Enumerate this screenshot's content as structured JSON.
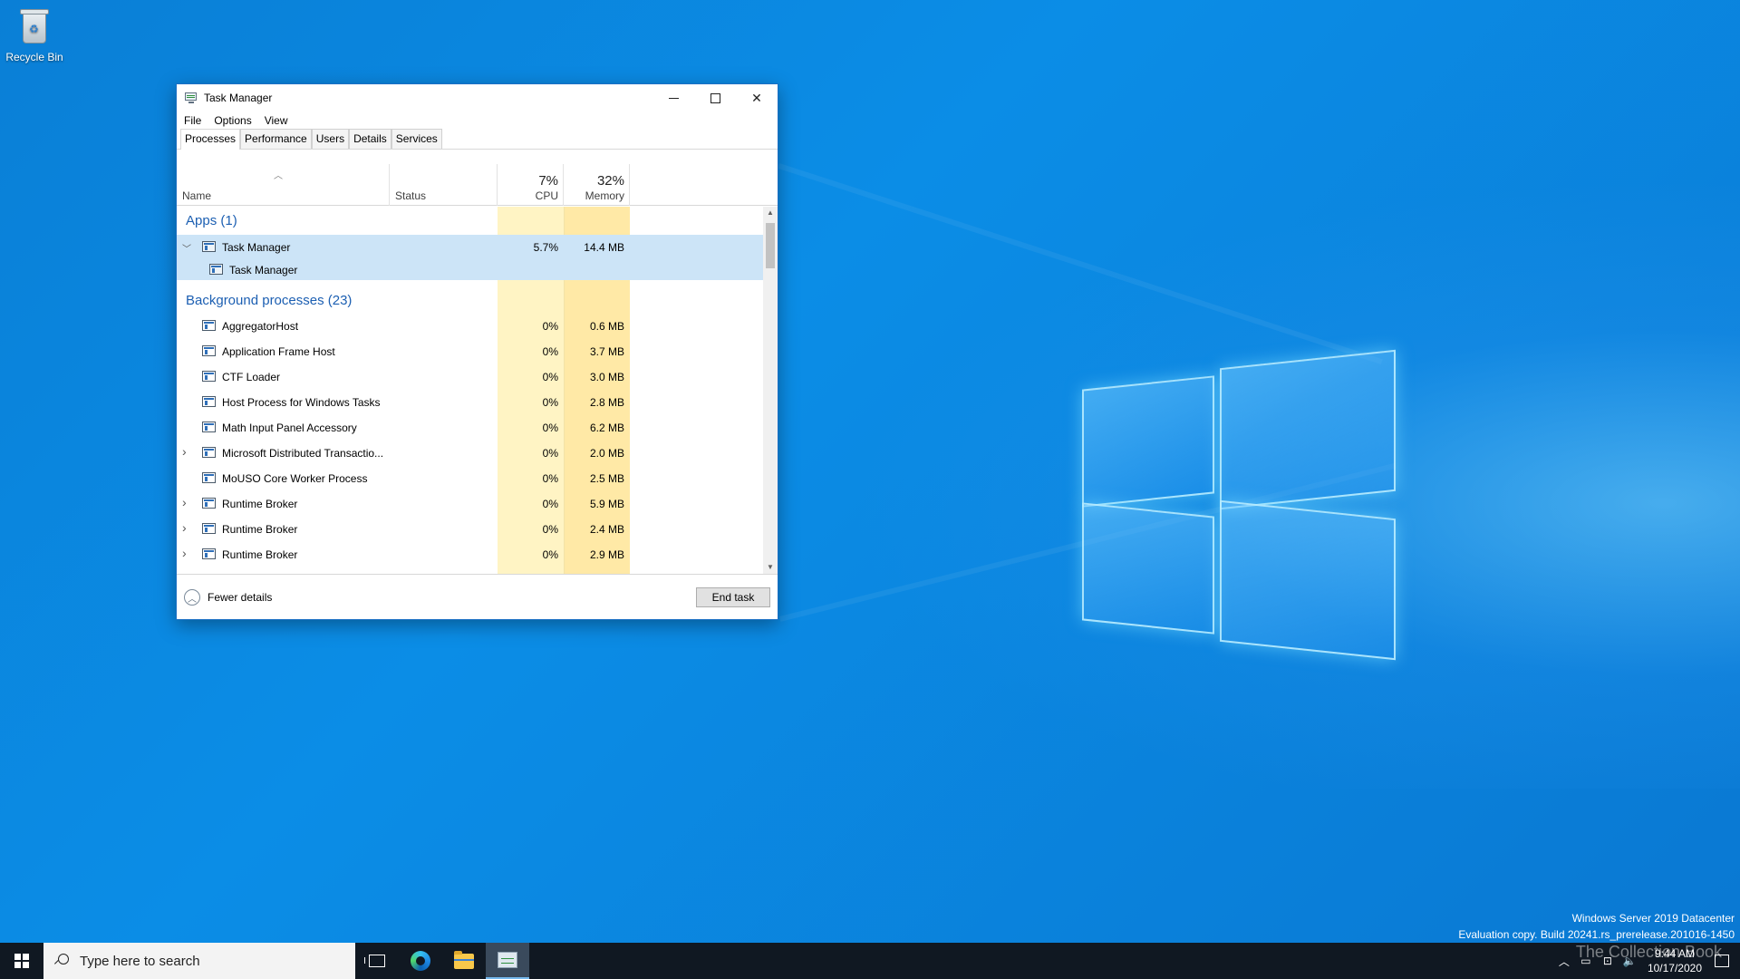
{
  "desktop": {
    "recycle_bin_label": "Recycle Bin",
    "watermark_line1": "Windows Server 2019 Datacenter",
    "watermark_line2": "Evaluation copy. Build 20241.rs_prerelease.201016-1450",
    "brand_text": "The Collection Book"
  },
  "window": {
    "title": "Task Manager",
    "menu": [
      "File",
      "Options",
      "View"
    ],
    "tabs": [
      "Processes",
      "Performance",
      "Users",
      "Details",
      "Services"
    ],
    "active_tab": "Processes",
    "columns": {
      "name": "Name",
      "status": "Status",
      "cpu_pct": "7%",
      "cpu": "CPU",
      "mem_pct": "32%",
      "mem": "Memory"
    },
    "groups": {
      "apps": "Apps (1)",
      "background": "Background processes (23)"
    },
    "apps": [
      {
        "name": "Task Manager",
        "cpu": "5.7%",
        "mem": "14.4 MB",
        "expanded": true,
        "child": "Task Manager"
      }
    ],
    "background": [
      {
        "name": "AggregatorHost",
        "cpu": "0%",
        "mem": "0.6 MB",
        "expandable": false,
        "icon": "process-icon"
      },
      {
        "name": "Application Frame Host",
        "cpu": "0%",
        "mem": "3.7 MB",
        "expandable": false,
        "icon": "process-icon"
      },
      {
        "name": "CTF Loader",
        "cpu": "0%",
        "mem": "3.0 MB",
        "expandable": false,
        "icon": "ctf-loader-icon"
      },
      {
        "name": "Host Process for Windows Tasks",
        "cpu": "0%",
        "mem": "2.8 MB",
        "expandable": false,
        "icon": "process-icon"
      },
      {
        "name": "Math Input Panel Accessory",
        "cpu": "0%",
        "mem": "6.2 MB",
        "expandable": false,
        "icon": "math-input-icon"
      },
      {
        "name": "Microsoft Distributed Transactio...",
        "cpu": "0%",
        "mem": "2.0 MB",
        "expandable": true,
        "icon": "msdtc-icon"
      },
      {
        "name": "MoUSO Core Worker Process",
        "cpu": "0%",
        "mem": "2.5 MB",
        "expandable": false,
        "icon": "process-icon"
      },
      {
        "name": "Runtime Broker",
        "cpu": "0%",
        "mem": "5.9 MB",
        "expandable": true,
        "icon": "process-icon"
      },
      {
        "name": "Runtime Broker",
        "cpu": "0%",
        "mem": "2.4 MB",
        "expandable": true,
        "icon": "process-icon"
      },
      {
        "name": "Runtime Broker",
        "cpu": "0%",
        "mem": "2.9 MB",
        "expandable": true,
        "icon": "process-icon"
      }
    ],
    "footer": {
      "fewer_details": "Fewer details",
      "end_task": "End task"
    }
  },
  "taskbar": {
    "search_placeholder": "Type here to search",
    "time": "9:44 AM",
    "date": "10/17/2020",
    "pinned": [
      "task-view-icon",
      "edge-icon",
      "file-explorer-icon",
      "task-manager-icon"
    ]
  }
}
